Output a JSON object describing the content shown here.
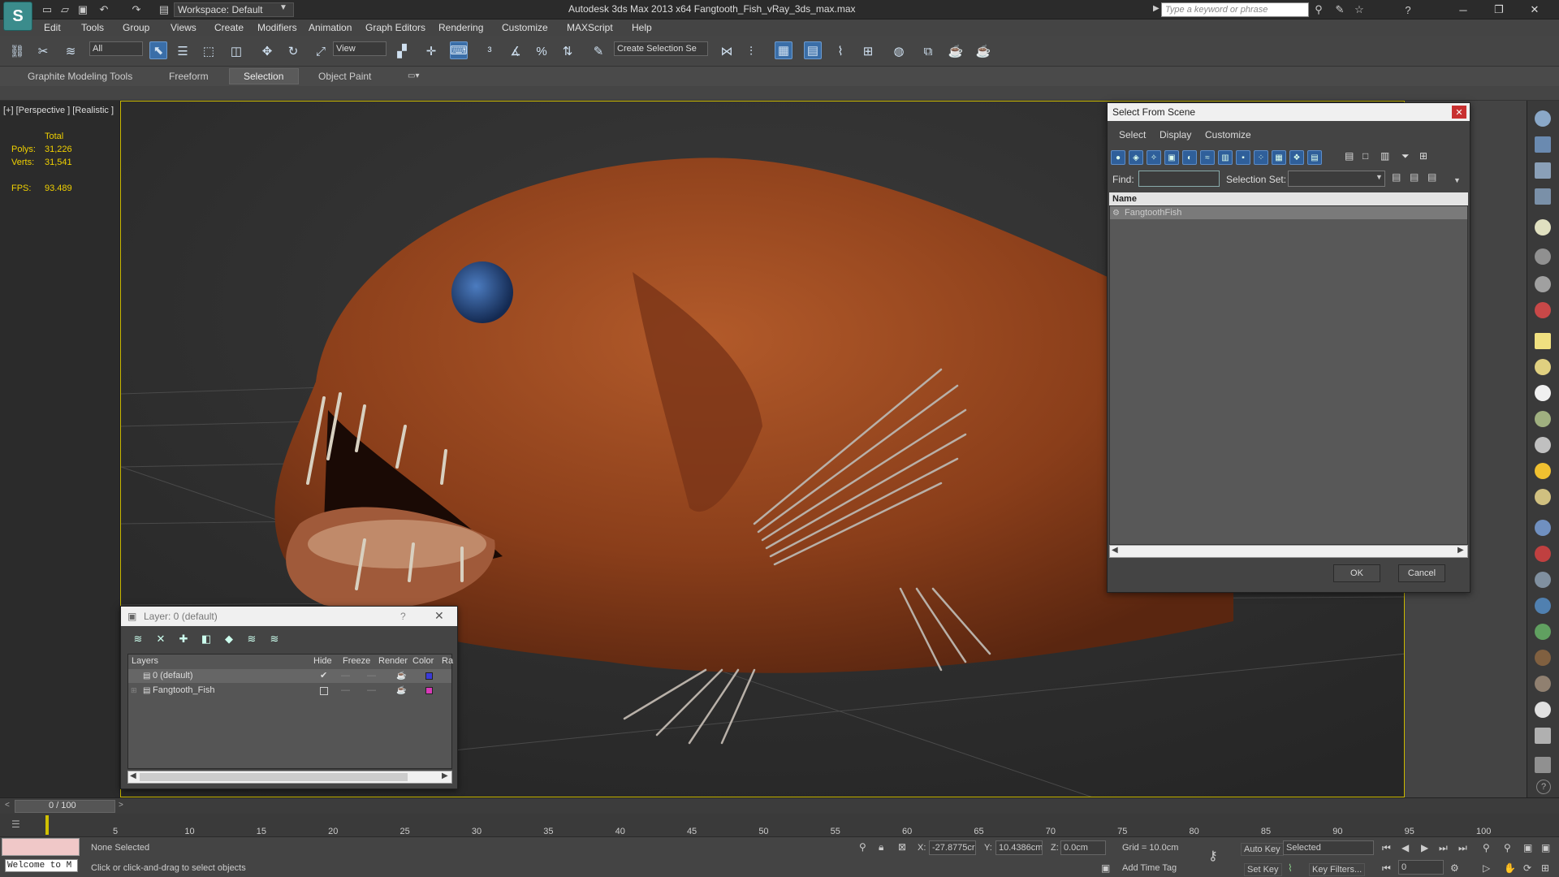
{
  "titlebar": {
    "workspace": "Workspace: Default",
    "title": "Autodesk 3ds Max  2013 x64      Fangtooth_Fish_vRay_3ds_max.max",
    "search_placeholder": "Type a keyword or phrase"
  },
  "menu": [
    "Edit",
    "Tools",
    "Group",
    "Views",
    "Create",
    "Modifiers",
    "Animation",
    "Graph Editors",
    "Rendering",
    "Customize",
    "MAXScript",
    "Help"
  ],
  "toolbar": {
    "filter_value": "All",
    "refcoord_value": "View",
    "named_selection_value": "Create Selection Se"
  },
  "ribbon_tabs": [
    "Graphite Modeling Tools",
    "Freeform",
    "Selection",
    "Object Paint"
  ],
  "viewport": {
    "label": "[+] [Perspective ] [Realistic ]",
    "stats_total": "Total",
    "polys_label": "Polys:",
    "polys_value": "31,226",
    "verts_label": "Verts:",
    "verts_value": "31,541",
    "fps_label": "FPS:",
    "fps_value": "93.489"
  },
  "select_from_scene": {
    "title": "Select From Scene",
    "menus": [
      "Select",
      "Display",
      "Customize"
    ],
    "find_label": "Find:",
    "selection_set_label": "Selection Set:",
    "column_name": "Name",
    "object": "FangtoothFish",
    "ok_label": "OK",
    "cancel_label": "Cancel"
  },
  "layer_dialog": {
    "title": "Layer: 0 (default)",
    "help": "?",
    "columns": [
      "Layers",
      "Hide",
      "Freeze",
      "Render",
      "Color",
      "Ra"
    ],
    "rows": [
      {
        "name": "0 (default)",
        "color": "#3a3ad8"
      },
      {
        "name": "Fangtooth_Fish",
        "color": "#d83ab8"
      }
    ]
  },
  "timeline": {
    "frame": "0 / 100",
    "ticks": [
      "5",
      "10",
      "15",
      "20",
      "25",
      "30",
      "35",
      "40",
      "45",
      "50",
      "55",
      "60",
      "65",
      "70",
      "75",
      "80",
      "85",
      "90",
      "95",
      "100"
    ]
  },
  "status": {
    "welcome": "Welcome to M",
    "selection": "None Selected",
    "prompt": "Click or click-and-drag to select objects",
    "x_label": "X:",
    "x_value": "-27.8775cr",
    "y_label": "Y:",
    "y_value": "10.4386cm",
    "z_label": "Z:",
    "z_value": "0.0cm",
    "grid": "Grid = 10.0cm",
    "add_time_tag": "Add Time Tag",
    "auto_key": "Auto Key",
    "set_key": "Set Key",
    "key_mode_value": "Selected",
    "key_filters": "Key Filters...",
    "frame_value": "0"
  },
  "colors": {
    "viewport_border": "#c9b800",
    "stats": "#f0d000",
    "accent_blue": "#3a6ea8",
    "fish_body": "#9a4a22"
  }
}
